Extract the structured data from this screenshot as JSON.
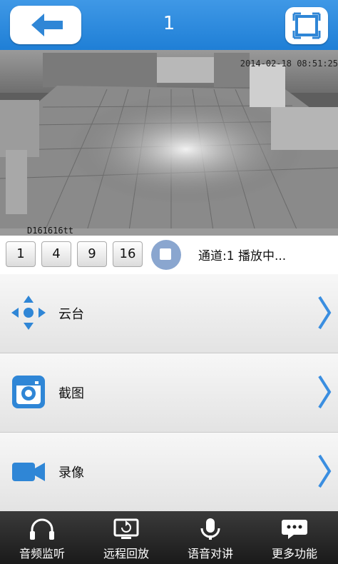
{
  "header": {
    "title": "1"
  },
  "video": {
    "timestamp": "2014-02-18 08:51:25",
    "camera_label": "D161616tt"
  },
  "controls": {
    "grid_buttons": [
      "1",
      "4",
      "9",
      "16"
    ],
    "status": "通道:1 播放中..."
  },
  "menu": {
    "items": [
      {
        "label": "云台",
        "icon": "ptz-arrows-icon"
      },
      {
        "label": "截图",
        "icon": "camera-icon"
      },
      {
        "label": "录像",
        "icon": "video-camera-icon"
      }
    ]
  },
  "tabs": [
    {
      "label": "音频监听",
      "icon": "headphones-icon"
    },
    {
      "label": "远程回放",
      "icon": "playback-monitor-icon"
    },
    {
      "label": "语音对讲",
      "icon": "microphone-icon"
    },
    {
      "label": "更多功能",
      "icon": "chat-bubble-icon"
    }
  ],
  "colors": {
    "accent": "#1f7fd6",
    "icon_blue": "#2f86d6",
    "bottom_bar": "#222222"
  }
}
